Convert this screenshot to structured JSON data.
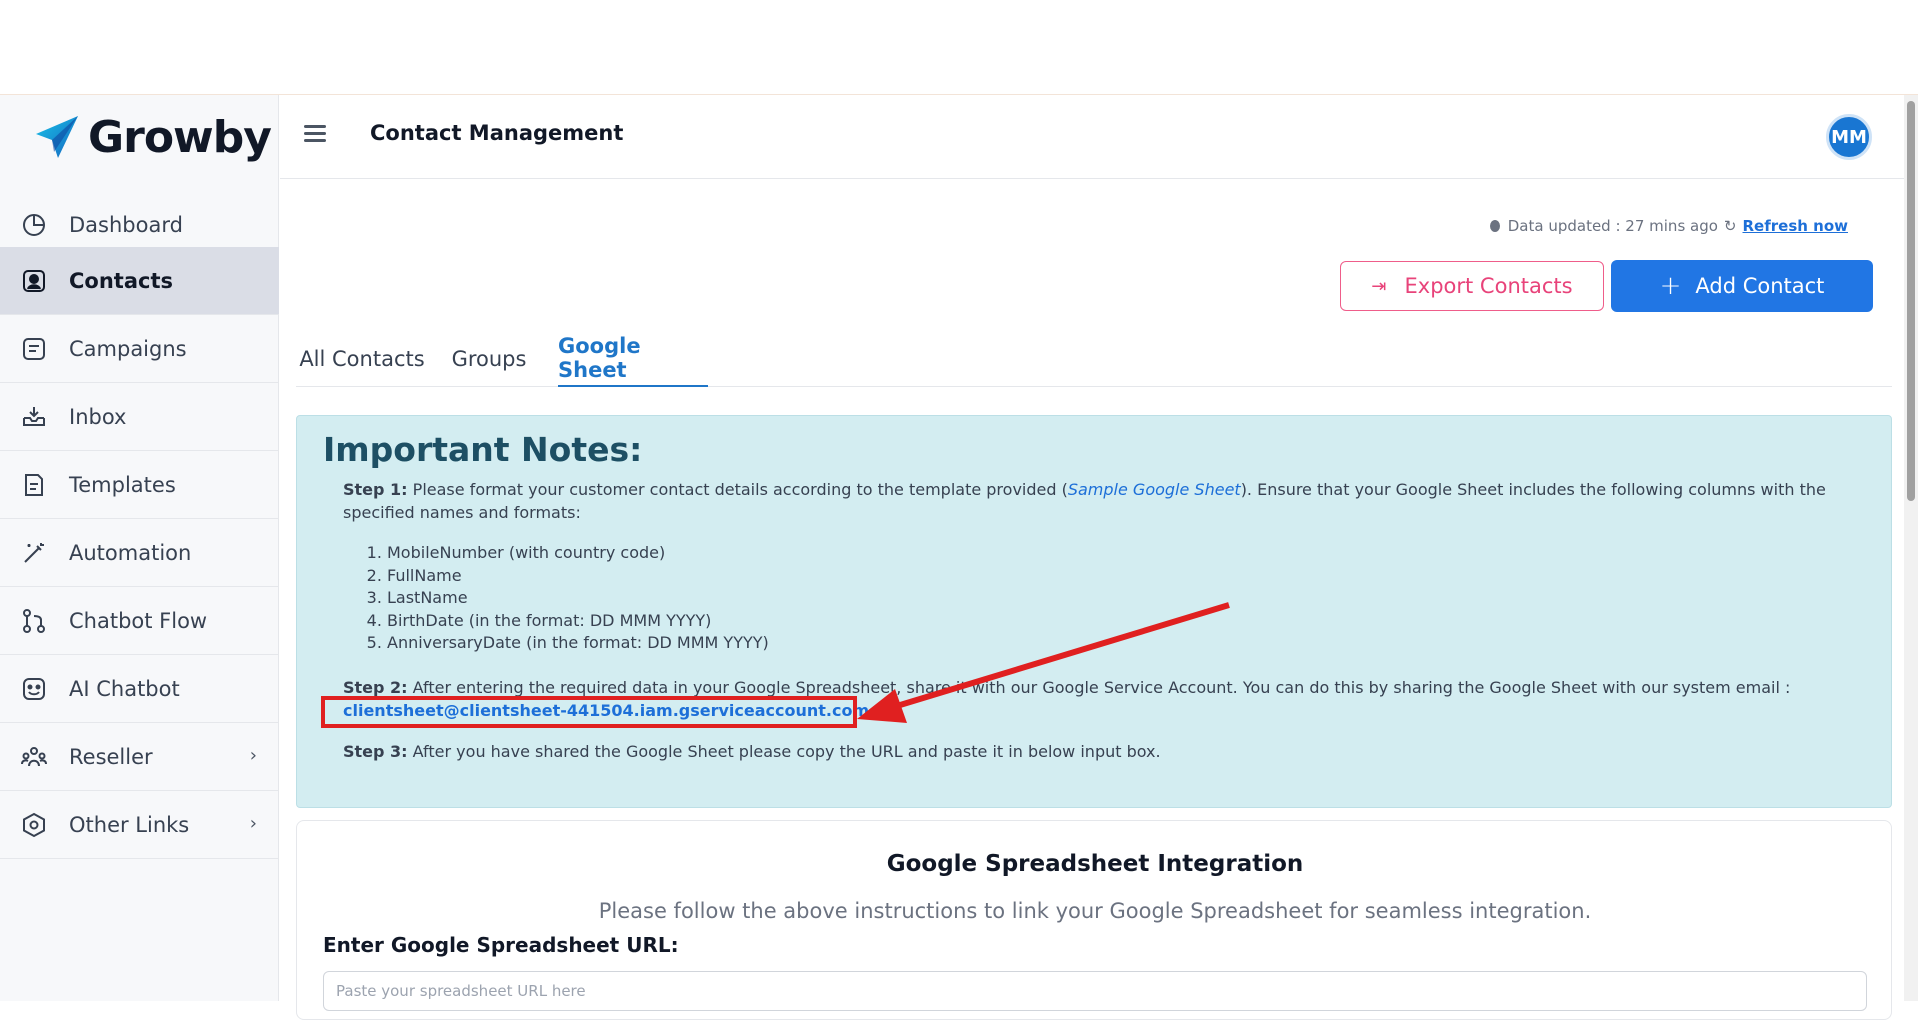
{
  "brand": {
    "name": "Growby"
  },
  "sidebar": {
    "items": [
      {
        "label": "Dashboard",
        "icon": "pie-chart-icon"
      },
      {
        "label": "Contacts",
        "icon": "contact-icon",
        "active": true
      },
      {
        "label": "Campaigns",
        "icon": "campaign-icon"
      },
      {
        "label": "Inbox",
        "icon": "inbox-icon"
      },
      {
        "label": "Templates",
        "icon": "template-icon"
      },
      {
        "label": "Automation",
        "icon": "magic-wand-icon"
      },
      {
        "label": "Chatbot Flow",
        "icon": "flow-icon"
      },
      {
        "label": "AI Chatbot",
        "icon": "bot-icon"
      },
      {
        "label": "Reseller",
        "icon": "users-icon",
        "chevron": true
      },
      {
        "label": "Other Links",
        "icon": "hexagon-icon",
        "chevron": true
      }
    ]
  },
  "header": {
    "title": "Contact Management",
    "avatar_initials": "MM"
  },
  "status": {
    "updated_text": "Data updated : 27 mins ago",
    "refresh_label": "Refresh now"
  },
  "actions": {
    "export_label": "Export Contacts",
    "add_label": "Add Contact"
  },
  "tabs": [
    {
      "label": "All Contacts"
    },
    {
      "label": "Groups"
    },
    {
      "label": "Google Sheet",
      "active": true
    }
  ],
  "notes": {
    "title": "Important Notes:",
    "step1_label": "Step 1:",
    "step1_text_a": "Please format your customer contact details according to the template provided (",
    "step1_link": "Sample Google Sheet",
    "step1_text_b": "). Ensure that your Google Sheet includes the following columns with the",
    "step1_text_c": "specified names and formats:",
    "columns": [
      "MobileNumber (with country code)",
      "FullName",
      "LastName",
      "BirthDate (in the format: DD MMM YYYY)",
      "AnniversaryDate (in the format: DD MMM YYYY)"
    ],
    "step2_label": "Step 2:",
    "step2_text": "After entering the required data in your Google Spreadsheet, share it with our Google Service Account. You can do this by sharing the Google Sheet with our system email :",
    "email": "clientsheet@clientsheet-441504.iam.gserviceaccount.com",
    "step3_label": "Step 3:",
    "step3_text": "After you have shared the Google Sheet please copy the URL and paste it in below input box."
  },
  "integration": {
    "title": "Google Spreadsheet Integration",
    "subtitle": "Please follow the above instructions to link your Google Spreadsheet for seamless integration.",
    "url_label": "Enter Google Spreadsheet URL:",
    "url_placeholder": "Paste your spreadsheet URL here",
    "url_value": ""
  },
  "colors": {
    "accent": "#2176e4",
    "export": "#e8437a",
    "notes_bg": "#d3edf1",
    "annotation_red": "#e02020"
  }
}
